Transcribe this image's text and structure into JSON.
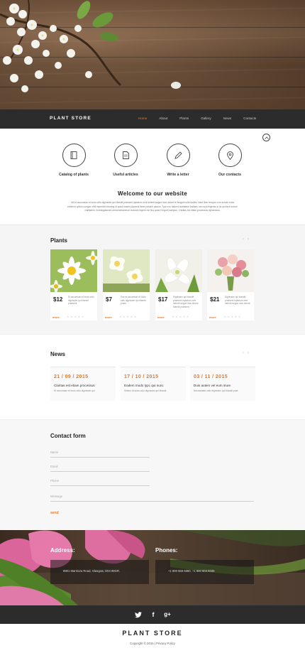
{
  "nav": {
    "brand": "PLANT STORE",
    "items": [
      {
        "label": "Home",
        "active": true
      },
      {
        "label": "About",
        "active": false
      },
      {
        "label": "Plants",
        "active": false
      },
      {
        "label": "Gallery",
        "active": false
      },
      {
        "label": "News",
        "active": false
      },
      {
        "label": "Contacts",
        "active": false
      }
    ]
  },
  "features": [
    {
      "label": "Catalog of plants",
      "icon": "book-icon"
    },
    {
      "label": "Useful articles",
      "icon": "document-icon"
    },
    {
      "label": "Write a letter",
      "icon": "pencil-icon"
    },
    {
      "label": "Our contacts",
      "icon": "map-pin-icon"
    }
  ],
  "welcome": {
    "title": "Welcome to our website",
    "text": "Vel et accumsan et iusto odio dignissim qui blandit praesent luptatum zzril delenit augue duis dolore te feugait nulla facilisi. Nam liber tempor cum soluta nobis eleifend option congue nihil imperdiet doming id quod mazim placerat facer possim assum. Typi non habent claritatem insitam; est usus legentis in iis qui facit eorum claritatem. Investigationes demonstraverunt lectores legere me lius quod ii legunt saepius. Claritas est etiam processus dynamicus."
  },
  "plants": {
    "title": "Plants",
    "more_label": "more",
    "items": [
      {
        "price": "$12",
        "desc": "Et accumsan et iusto odio dignissim qui blandit praesent"
      },
      {
        "price": "$7",
        "desc": "Eos et accumsan et iusto odio dignissim qui blandit praes"
      },
      {
        "price": "$17",
        "desc": "Dignissim qui blandit praesent luptatum zzril delenit augue duis dolore blandit praesent"
      },
      {
        "price": "$21",
        "desc": "Dignissim qui blandit praesent luptatum zzril delenit augue duis dolore"
      }
    ]
  },
  "news": {
    "title": "News",
    "posts": [
      {
        "date": "21 / 09 / 2015",
        "title": "Claritas est etiam processus",
        "text": "Et accumsan et iusto odio dignissim qui"
      },
      {
        "date": "17 / 10 / 2015",
        "title": "Eodem modo typi, qui nunc",
        "text": "Seisen et iusto odio dignissim qui blandit"
      },
      {
        "date": "03 / 11 / 2015",
        "title": "Duis autem vel eum iriure",
        "text": "Necessitate odio dignissim qui blandit prae"
      }
    ]
  },
  "contact": {
    "title": "Contact form",
    "name_placeholder": "Name",
    "email_placeholder": "Email",
    "phone_placeholder": "Phone",
    "message_placeholder": "Message",
    "send_label": "send"
  },
  "info": {
    "address_label": "Address:",
    "address": "8901 Marmora Road, Glasgow, D04 89GR.",
    "phones_label": "Phones:",
    "phones": "+1 800 559 6580, +1 800 603 6035"
  },
  "footer": {
    "brand": "PLANT STORE",
    "copyright": "Copyright © 2015 | Privacy Policy"
  },
  "colors": {
    "accent": "#e8782a",
    "dark": "#2c2c2c"
  }
}
